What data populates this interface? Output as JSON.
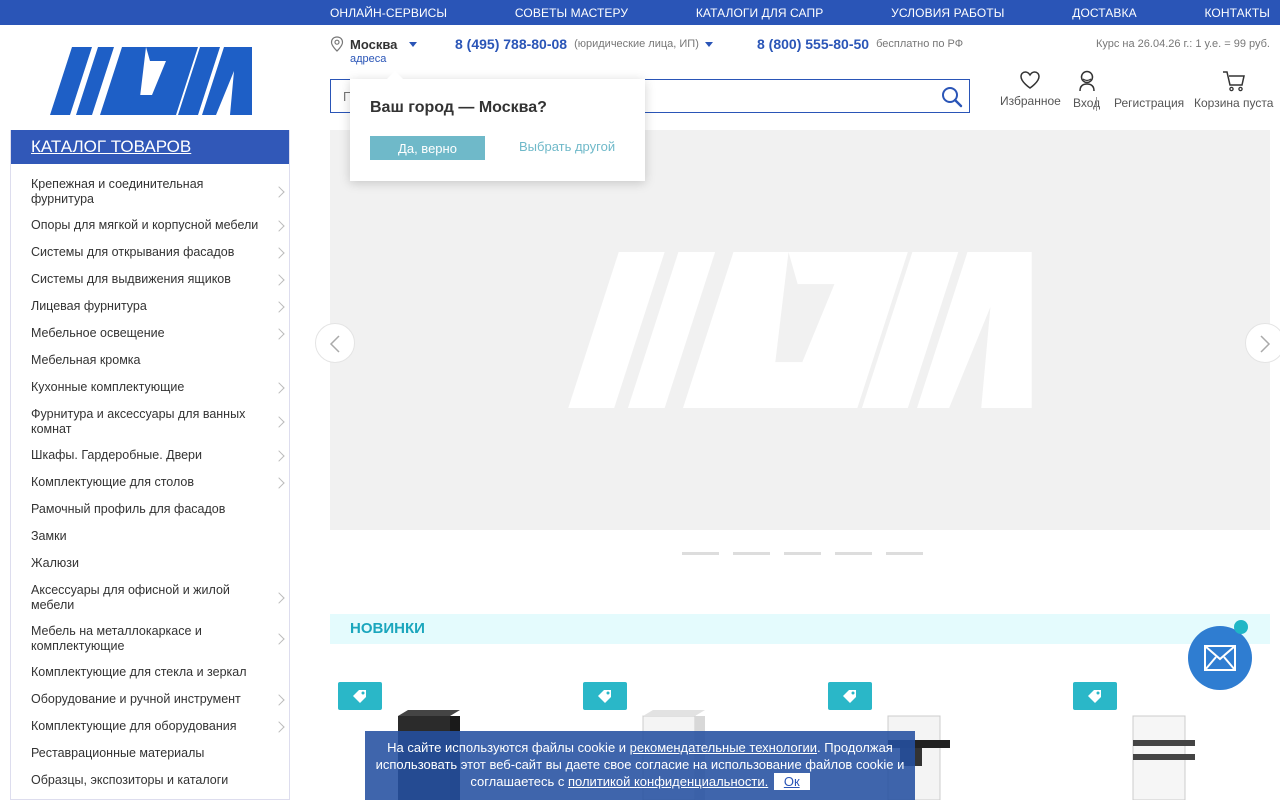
{
  "topnav": [
    "ОНЛАЙН-СЕРВИСЫ",
    "СОВЕТЫ МАСТЕРУ",
    "КАТАЛОГИ ДЛЯ САПР",
    "УСЛОВИЯ РАБОТЫ",
    "ДОСТАВКА",
    "КОНТАКТЫ"
  ],
  "header": {
    "city": "Москва",
    "city_sub": "адреса",
    "phone1": "8 (495) 788-80-08",
    "phone1_note": "(юридические лица, ИП)",
    "phone2": "8 (800) 555-80-50",
    "phone2_note": "бесплатно по РФ",
    "rate": "Курс на 26.04.26 г.: 1 у.е. = 99 руб.",
    "search_placeholder": "Поиск",
    "favorites": "Избранное",
    "login": "Вход",
    "register": "Регистрация",
    "cart": "Корзина пуста"
  },
  "popup": {
    "title": "Ваш город — Москва?",
    "yes": "Да, верно",
    "other": "Выбрать другой"
  },
  "catalog": {
    "title": "КАТАЛОГ ТОВАРОВ",
    "items": [
      {
        "label": "Крепежная и соединительная фурнитура",
        "sub": true
      },
      {
        "label": "Опоры для мягкой и корпусной мебели",
        "sub": true
      },
      {
        "label": "Системы для открывания фасадов",
        "sub": true
      },
      {
        "label": "Системы для выдвижения ящиков",
        "sub": true
      },
      {
        "label": "Лицевая фурнитура",
        "sub": true
      },
      {
        "label": "Мебельное освещение",
        "sub": true
      },
      {
        "label": "Мебельная кромка",
        "sub": false
      },
      {
        "label": "Кухонные комплектующие",
        "sub": true
      },
      {
        "label": "Фурнитура и аксессуары для ванных комнат",
        "sub": true
      },
      {
        "label": "Шкафы. Гардеробные. Двери",
        "sub": true
      },
      {
        "label": "Комплектующие для столов",
        "sub": true
      },
      {
        "label": "Рамочный профиль для фасадов",
        "sub": false
      },
      {
        "label": "Замки",
        "sub": false
      },
      {
        "label": "Жалюзи",
        "sub": false
      },
      {
        "label": "Аксессуары для офисной и жилой мебели",
        "sub": true
      },
      {
        "label": "Мебель на металлокаркасе и комплектующие",
        "sub": true
      },
      {
        "label": "Комплектующие для стекла и зеркал",
        "sub": false
      },
      {
        "label": "Оборудование и ручной инструмент",
        "sub": true
      },
      {
        "label": "Комплектующие для оборудования",
        "sub": true
      },
      {
        "label": "Реставрационные материалы",
        "sub": false
      },
      {
        "label": "Образцы, экспозиторы и каталоги",
        "sub": false
      }
    ]
  },
  "slider": {
    "slide_count": 5,
    "active": 1
  },
  "news": {
    "title": "НОВИНКИ"
  },
  "cookie": {
    "t1": "На сайте используются файлы cookie и ",
    "link1": "рекомендательные технологии",
    "t2": ". Продолжая использовать этот веб-сайт вы даете свое согласие на использование файлов cookie и соглашаетесь с ",
    "link2": "политикой конфиденциальности.",
    "ok": "Ок"
  },
  "colors": {
    "brand": "#2a55b7",
    "accent": "#1ba6bd"
  }
}
